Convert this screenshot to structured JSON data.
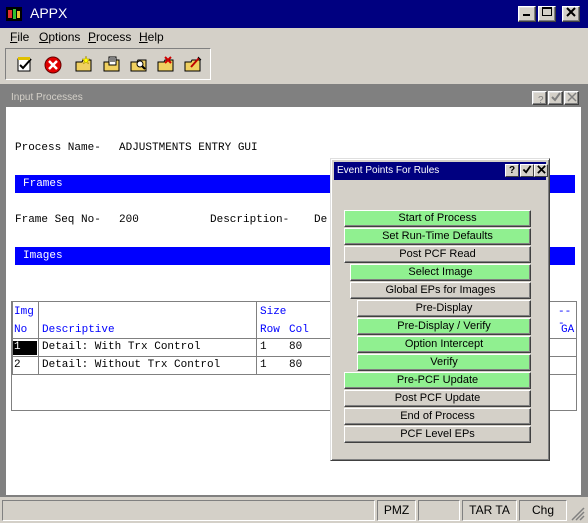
{
  "app": {
    "title": "APPX"
  },
  "menu": [
    {
      "label": "File",
      "key": "F",
      "rest": "ile"
    },
    {
      "label": "Options",
      "key": "O",
      "rest": "ptions"
    },
    {
      "label": "Process",
      "key": "P",
      "rest": "rocess"
    },
    {
      "label": "Help",
      "key": "H",
      "rest": "elp"
    }
  ],
  "toolbar_icons": [
    "checklist-icon",
    "stop-icon",
    "new-folder-icon",
    "open-folder-icon",
    "find-folder-icon",
    "delete-folder-icon",
    "edit-folder-icon"
  ],
  "inner": {
    "title": "Input Processes",
    "process_label": "Process Name-",
    "process_name": "ADJUSTMENTS ENTRY GUI",
    "frames_header": "Frames",
    "frame_seq_label": "Frame Seq No-",
    "frame_seq": "200",
    "description_label": "Description-",
    "description_trunc": "De",
    "images_header": "Images",
    "grid": {
      "col_img": "Img",
      "col_no": "No",
      "col_desc": "Descriptive",
      "col_size": "Size",
      "col_row": "Row",
      "col_col": "Col",
      "col_dash": "---",
      "col_ga": "GA",
      "rows": [
        {
          "no": "1",
          "desc": "Detail: With Trx Control",
          "row": "1",
          "col": "80"
        },
        {
          "no": "2",
          "desc": "Detail: Without Trx Control",
          "row": "1",
          "col": "80"
        }
      ]
    }
  },
  "dialog": {
    "title": "Event Points For Rules",
    "buttons": [
      {
        "label": "Start of Process",
        "color": "green"
      },
      {
        "label": "Set Run-Time Defaults",
        "color": "green"
      },
      {
        "label": "Post PCF Read",
        "color": "grey"
      },
      {
        "label": "Select Image",
        "color": "green"
      },
      {
        "label": "Global EPs for Images",
        "color": "grey"
      },
      {
        "label": "Pre-Display",
        "color": "grey"
      },
      {
        "label": "Pre-Display / Verify",
        "color": "green"
      },
      {
        "label": "Option Intercept",
        "color": "green"
      },
      {
        "label": "Verify",
        "color": "green"
      },
      {
        "label": "Pre-PCF Update",
        "color": "green"
      },
      {
        "label": "Post PCF Update",
        "color": "grey"
      },
      {
        "label": "End of Process",
        "color": "grey"
      },
      {
        "label": "PCF Level EPs",
        "color": "grey"
      }
    ]
  },
  "status": {
    "pmz": "PMZ",
    "tar": "TAR TA",
    "chg": "Chg"
  },
  "colors": {
    "title_bg": "#000080",
    "blue_bar": "#0000ff",
    "green_btn": "#90f090"
  }
}
